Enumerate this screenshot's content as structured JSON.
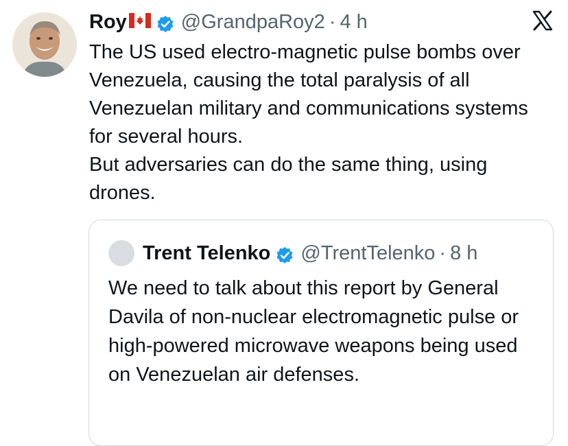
{
  "tweet": {
    "author_name": "Roy",
    "author_flag": "canada-flag",
    "author_handle": "@GrandpaRoy2",
    "separator": "·",
    "time": "4 h",
    "text_line_1": "The US used electro-magnetic pulse bombs over Venezuela, causing the total paralysis of all Venezuelan military and communications systems for several hours.",
    "text_line_2": "But adversaries can do the same thing, using drones."
  },
  "quoted_tweet": {
    "author_name": "Trent Telenko",
    "author_handle": "@TrentTelenko",
    "separator": "·",
    "time": "8 h",
    "text": "We need to talk about this report by General Davila of non-nuclear electromagnetic pulse or high-powered microwave weapons being used on Venezuelan air defenses."
  },
  "icons": {
    "platform": "x-logo",
    "verified": "verified-badge-icon",
    "flag": "canada-flag-icon"
  },
  "colors": {
    "text": "#0f1419",
    "secondary": "#536471",
    "verified_blue": "#1d9bf0",
    "border": "#cfd9de"
  }
}
